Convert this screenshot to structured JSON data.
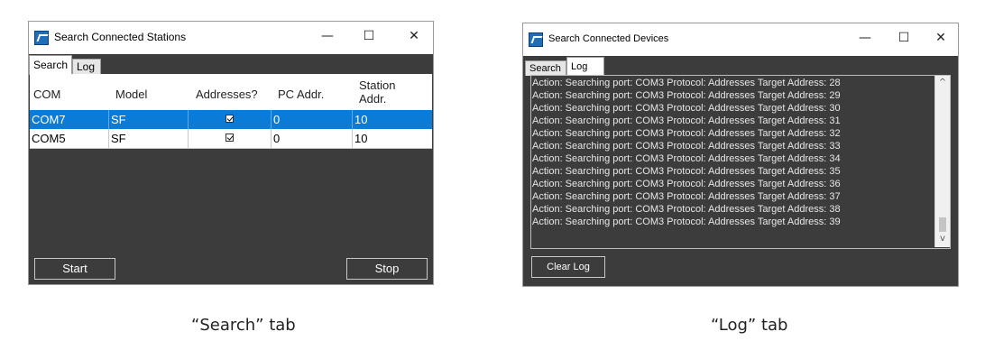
{
  "search_window": {
    "title": "Search Connected Stations",
    "controls": {
      "minimize": "—",
      "maximize": "☐",
      "close": "✕"
    },
    "tabs": [
      {
        "label": "Search",
        "active": true
      },
      {
        "label": "Log",
        "active": false
      }
    ],
    "columns": [
      "COM",
      "Model",
      "Addresses?",
      "PC Addr.",
      "Station\nAddr."
    ],
    "rows": [
      {
        "com": "COM7",
        "model": "SF",
        "addresses": true,
        "pc_addr": "0",
        "station_addr": "10",
        "selected": true
      },
      {
        "com": "COM5",
        "model": "SF",
        "addresses": true,
        "pc_addr": "0",
        "station_addr": "10",
        "selected": false
      }
    ],
    "buttons": {
      "start": "Start",
      "stop": "Stop"
    },
    "selection_color": "#0a7bd6",
    "panel_color": "#3c3c3c"
  },
  "log_window": {
    "title": "Search Connected Devices",
    "controls": {
      "minimize": "—",
      "maximize": "☐",
      "close": "✕"
    },
    "tabs": [
      {
        "label": "Search",
        "active": false
      },
      {
        "label": "Log",
        "active": true
      }
    ],
    "log_lines": [
      "Action: Searching port: COM3 Protocol: Addresses Target Address: 28",
      "Action: Searching port: COM3 Protocol: Addresses Target Address: 29",
      "Action: Searching port: COM3 Protocol: Addresses Target Address: 30",
      "Action: Searching port: COM3 Protocol: Addresses Target Address: 31",
      "Action: Searching port: COM3 Protocol: Addresses Target Address: 32",
      "Action: Searching port: COM3 Protocol: Addresses Target Address: 33",
      "Action: Searching port: COM3 Protocol: Addresses Target Address: 34",
      "Action: Searching port: COM3 Protocol: Addresses Target Address: 35",
      "Action: Searching port: COM3 Protocol: Addresses Target Address: 36",
      "Action: Searching port: COM3 Protocol: Addresses Target Address: 37",
      "Action: Searching port: COM3 Protocol: Addresses Target Address: 38",
      "Action: Searching port: COM3 Protocol: Addresses Target Address: 39"
    ],
    "scroll": {
      "up": "^",
      "down": "v"
    },
    "buttons": {
      "clear_log": "Clear Log"
    }
  },
  "captions": {
    "search": "“Search” tab",
    "log": "“Log” tab"
  }
}
